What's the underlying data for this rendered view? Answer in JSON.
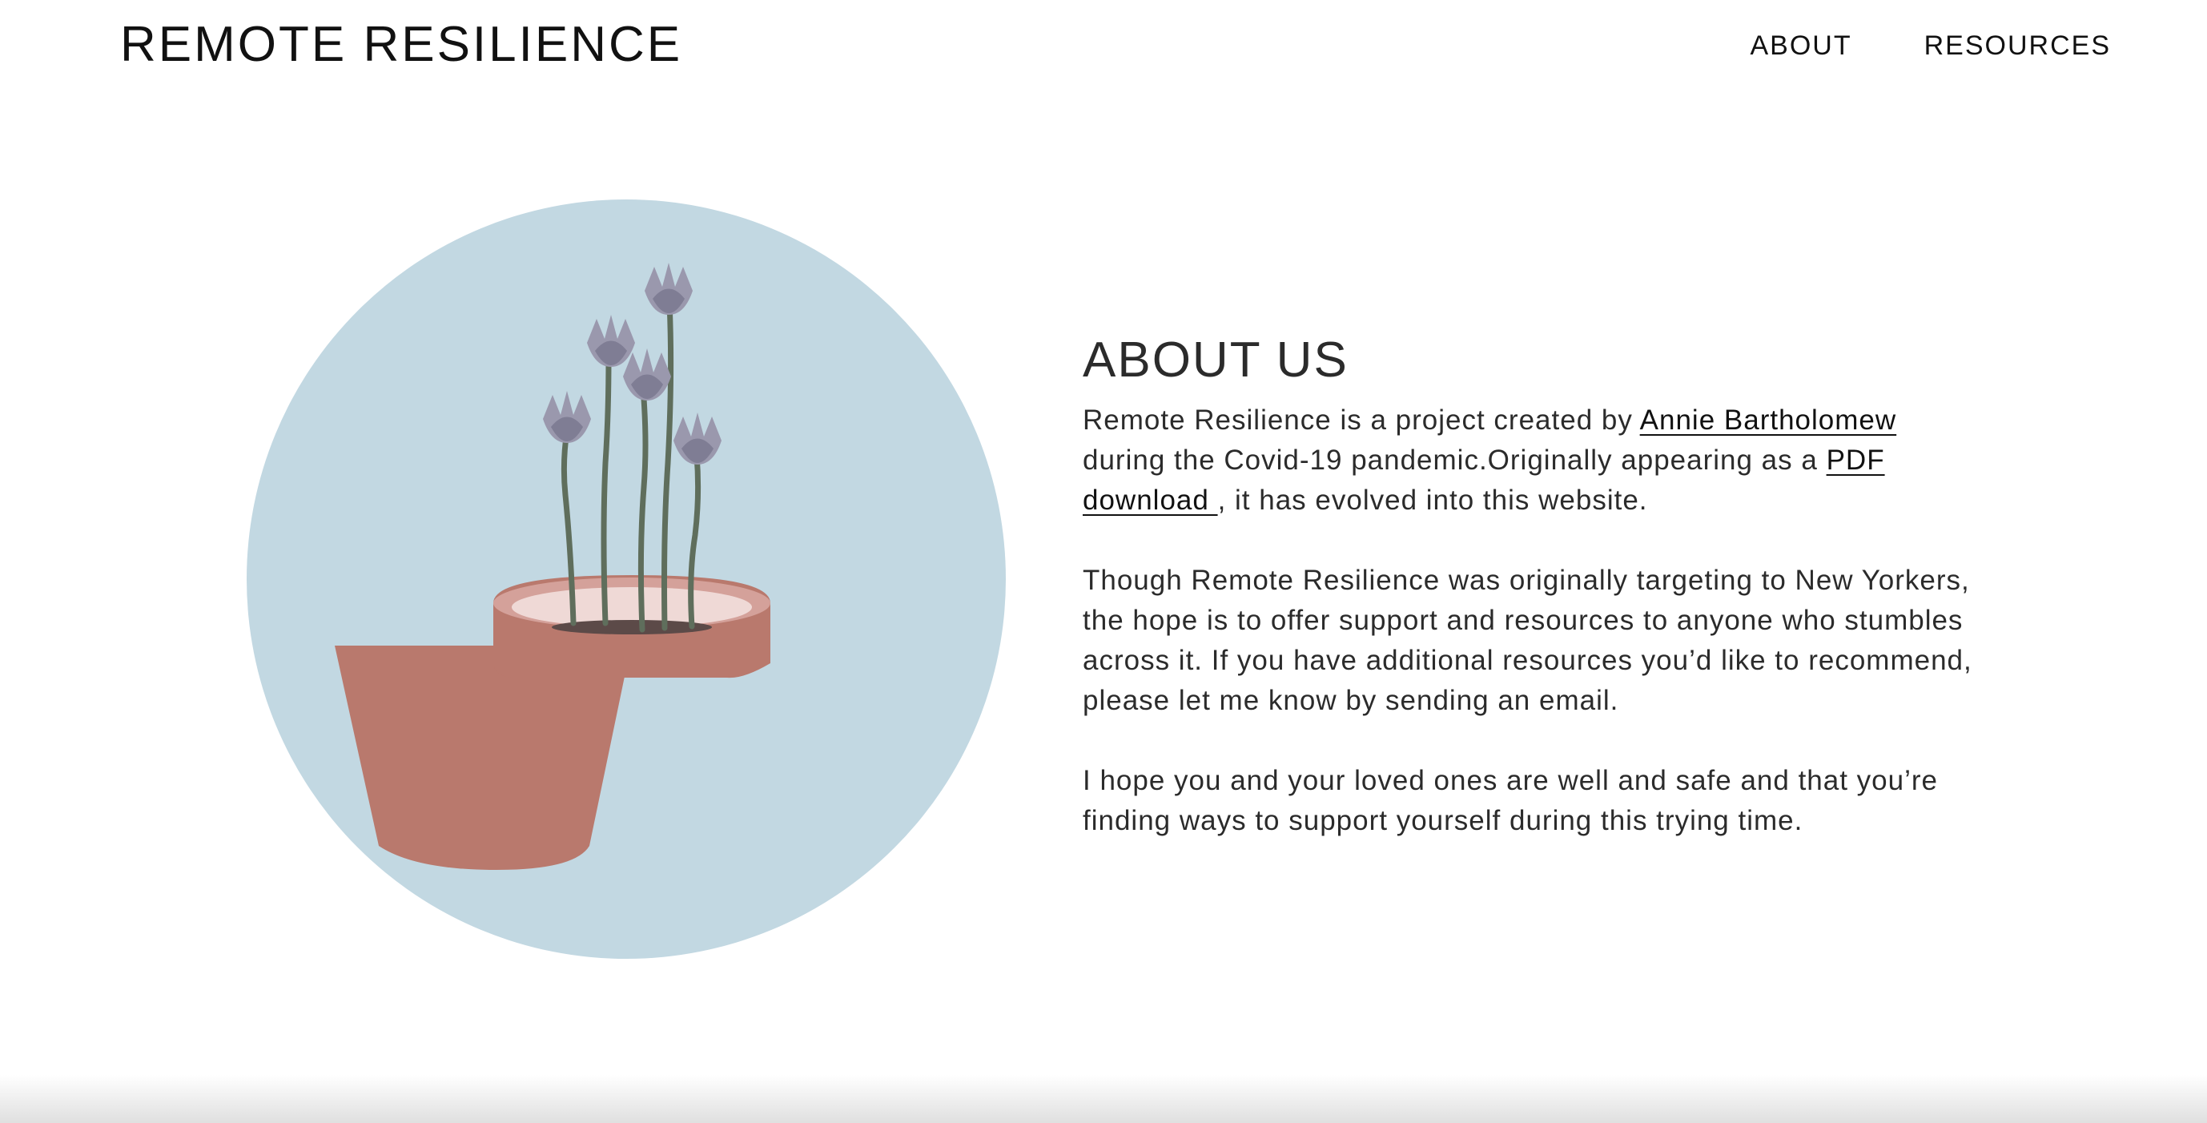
{
  "header": {
    "site_title": "REMOTE RESILIENCE",
    "nav": [
      {
        "label": "ABOUT"
      },
      {
        "label": "RESOURCES"
      }
    ]
  },
  "about": {
    "heading": "ABOUT US",
    "p1": {
      "text_before": "Remote Resilience is a project created by ",
      "author_link": "Annie Bartholomew",
      "text_middle": " during the Covid-19 pandemic.Originally appearing as a ",
      "pdf_link": "PDF download ",
      "text_after": ", it has evolved into this website."
    },
    "p2": "Though Remote Resilience was originally targeting to New Yorkers, the hope is to offer support and resources to anyone who stumbles across it. If you have additional resources you’d like to recommend, please let me know by sending an email.",
    "p3": "I hope you and your loved ones are well and safe and that you’re finding ways to support yourself during this trying time."
  },
  "colors": {
    "circle": "#c2d8e2",
    "pot": "#b9796d",
    "pot_rim": "#d4a19a",
    "soil": "#5c4a48",
    "stem": "#5f6e5c",
    "flower": "#9a98ad"
  },
  "illustration": {
    "icon": "potted-flowers-illustration"
  }
}
